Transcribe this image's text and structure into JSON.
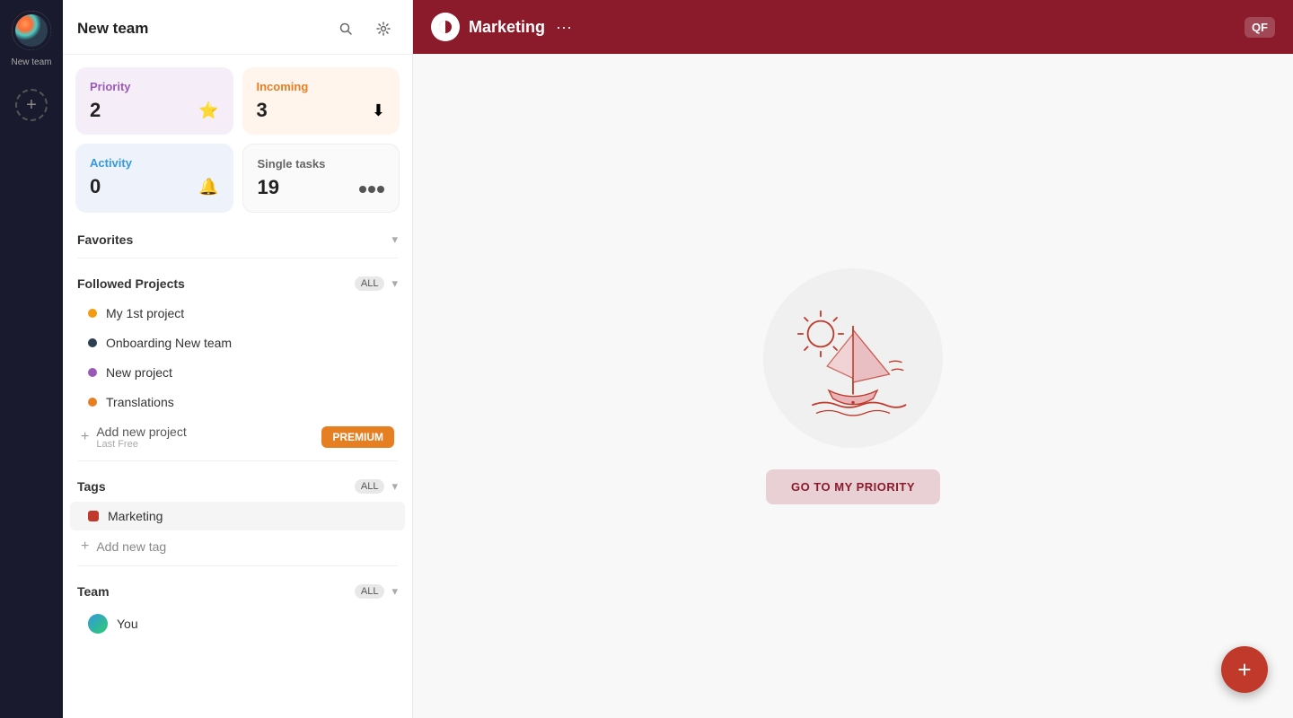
{
  "iconBar": {
    "teamName": "New team",
    "addLabel": "+"
  },
  "sidebar": {
    "title": "New team",
    "searchLabel": "search",
    "settingsLabel": "settings",
    "stats": {
      "priority": {
        "label": "Priority",
        "count": "2",
        "icon": "⭐"
      },
      "incoming": {
        "label": "Incoming",
        "count": "3",
        "icon": "⬇"
      },
      "activity": {
        "label": "Activity",
        "count": "0",
        "icon": "🔔"
      },
      "singleTasks": {
        "label": "Single tasks",
        "count": "19",
        "icon": "⚫"
      }
    },
    "favorites": {
      "title": "Favorites",
      "chevron": "▾"
    },
    "followedProjects": {
      "title": "Followed Projects",
      "badge": "ALL",
      "chevron": "▾",
      "projects": [
        {
          "label": "My 1st project",
          "color": "#f39c12"
        },
        {
          "label": "Onboarding New team",
          "color": "#2c3e50"
        },
        {
          "label": "New project",
          "color": "#9b59b6"
        },
        {
          "label": "Translations",
          "color": "#e67e22"
        }
      ],
      "addNew": {
        "label": "Add new project",
        "subLabel": "Last Free",
        "premiumLabel": "PREMIUM"
      }
    },
    "tags": {
      "title": "Tags",
      "badge": "ALL",
      "chevron": "▾",
      "items": [
        {
          "label": "Marketing",
          "color": "#c0392b"
        }
      ],
      "addNew": "Add new tag"
    },
    "team": {
      "title": "Team",
      "badge": "ALL",
      "chevron": "▾",
      "members": [
        {
          "label": "You",
          "color": "#3498db"
        }
      ]
    }
  },
  "header": {
    "logoAlt": "logo",
    "title": "Marketing",
    "menuDots": "···",
    "rightIcon": "QF"
  },
  "main": {
    "illustrationAlt": "sailboat illustration",
    "goButton": "GO TO MY PRIORITY"
  },
  "fab": {
    "label": "+"
  }
}
